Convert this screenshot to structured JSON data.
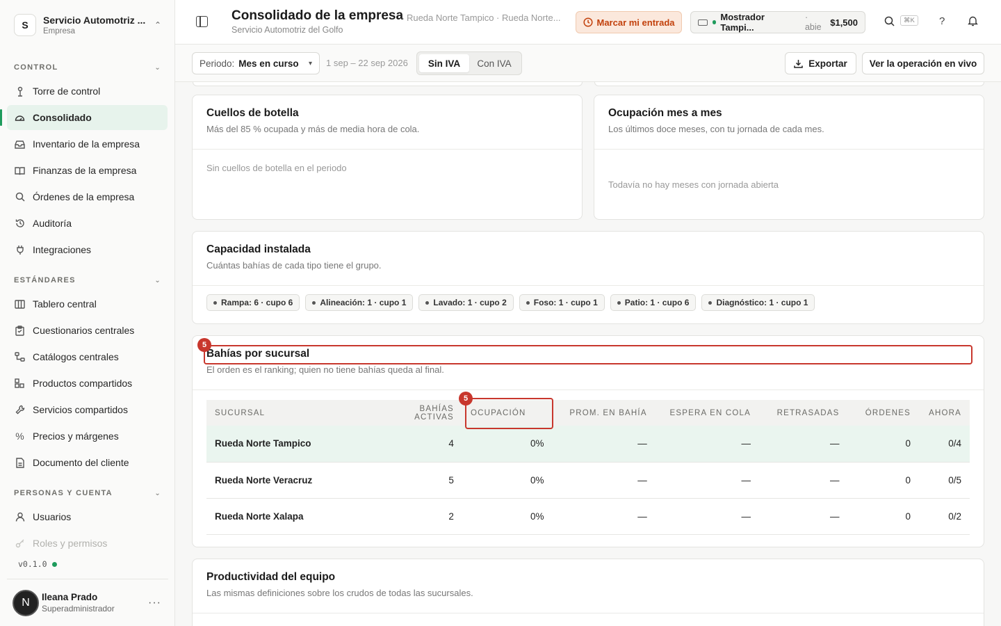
{
  "org": {
    "initial": "S",
    "name": "Servicio Automotriz ...",
    "type": "Empresa"
  },
  "sidebar": {
    "sections": [
      {
        "title": "CONTROL",
        "items": [
          "Torre de control",
          "Consolidado",
          "Inventario de la empresa",
          "Finanzas de la empresa",
          "Órdenes de la empresa",
          "Auditoría",
          "Integraciones"
        ]
      },
      {
        "title": "ESTÁNDARES",
        "items": [
          "Tablero central",
          "Cuestionarios centrales",
          "Catálogos centrales",
          "Productos compartidos",
          "Servicios compartidos",
          "Precios y márgenes",
          "Documento del cliente"
        ]
      },
      {
        "title": "PERSONAS Y CUENTA",
        "items": [
          "Usuarios",
          "Roles y permisos"
        ]
      }
    ],
    "active_item": "Consolidado",
    "version": "v0.1.0"
  },
  "user": {
    "initial": "N",
    "name": "Ileana Prado",
    "role": "Superadministrador"
  },
  "header": {
    "title": "Consolidado de la empresa",
    "subtitle": "Servicio Automotriz del Golfo",
    "breadcrumbs": "Rueda Norte Tampico · Rueda Norte...",
    "entry_button": "Marcar mi entrada",
    "counter": {
      "name": "Mostrador Tampi...",
      "status": "· abie",
      "amount": "$1,500"
    },
    "shortcut": "⌘K",
    "help": "?"
  },
  "filters": {
    "period_label": "Periodo:",
    "period_value": "Mes en curso",
    "date_range": "1 sep – 22 sep 2026",
    "tax_options": [
      "Sin IVA",
      "Con IVA"
    ],
    "tax_selected": "Sin IVA",
    "export_label": "Exportar",
    "live_label": "Ver la operación en vivo"
  },
  "cards": {
    "bottlenecks": {
      "title": "Cuellos de botella",
      "desc": "Más del 85 % ocupada y más de media hora de cola.",
      "empty": "Sin cuellos de botella en el periodo"
    },
    "occupancy": {
      "title": "Ocupación mes a mes",
      "desc": "Los últimos doce meses, con tu jornada de cada mes.",
      "empty": "Todavía no hay meses con jornada abierta"
    },
    "capacity": {
      "title": "Capacidad instalada",
      "desc": "Cuántas bahías de cada tipo tiene el grupo.",
      "chips": [
        "Rampa: 6 · cupo 6",
        "Alineación: 1 · cupo 1",
        "Lavado: 1 · cupo 2",
        "Foso: 1 · cupo 1",
        "Patio: 1 · cupo 6",
        "Diagnóstico: 1 · cupo 1"
      ]
    },
    "branches": {
      "title": "Bahías por sucursal",
      "desc": "El orden es el ranking; quien no tiene bahías queda al final.",
      "columns": [
        "SUCURSAL",
        "BAHÍAS ACTIVAS",
        "OCUPACIÓN",
        "PROM. EN BAHÍA",
        "ESPERA EN COLA",
        "RETRASADAS",
        "ÓRDENES",
        "AHORA"
      ],
      "rows": [
        [
          "Rueda Norte Tampico",
          "4",
          "0%",
          "—",
          "—",
          "—",
          "0",
          "0/4"
        ],
        [
          "Rueda Norte Veracruz",
          "5",
          "0%",
          "—",
          "—",
          "—",
          "0",
          "0/5"
        ],
        [
          "Rueda Norte Xalapa",
          "2",
          "0%",
          "—",
          "—",
          "—",
          "0",
          "0/2"
        ]
      ]
    },
    "productivity": {
      "title": "Productividad del equipo",
      "desc": "Las mismas definiciones sobre los crudos de todas las sucursales."
    }
  },
  "annotations": {
    "title_marker": "5",
    "column_marker": "5"
  },
  "colors": {
    "accent": "#1e9b5c",
    "highlight": "#c8372d",
    "entry_bg": "#fbe8dc"
  }
}
